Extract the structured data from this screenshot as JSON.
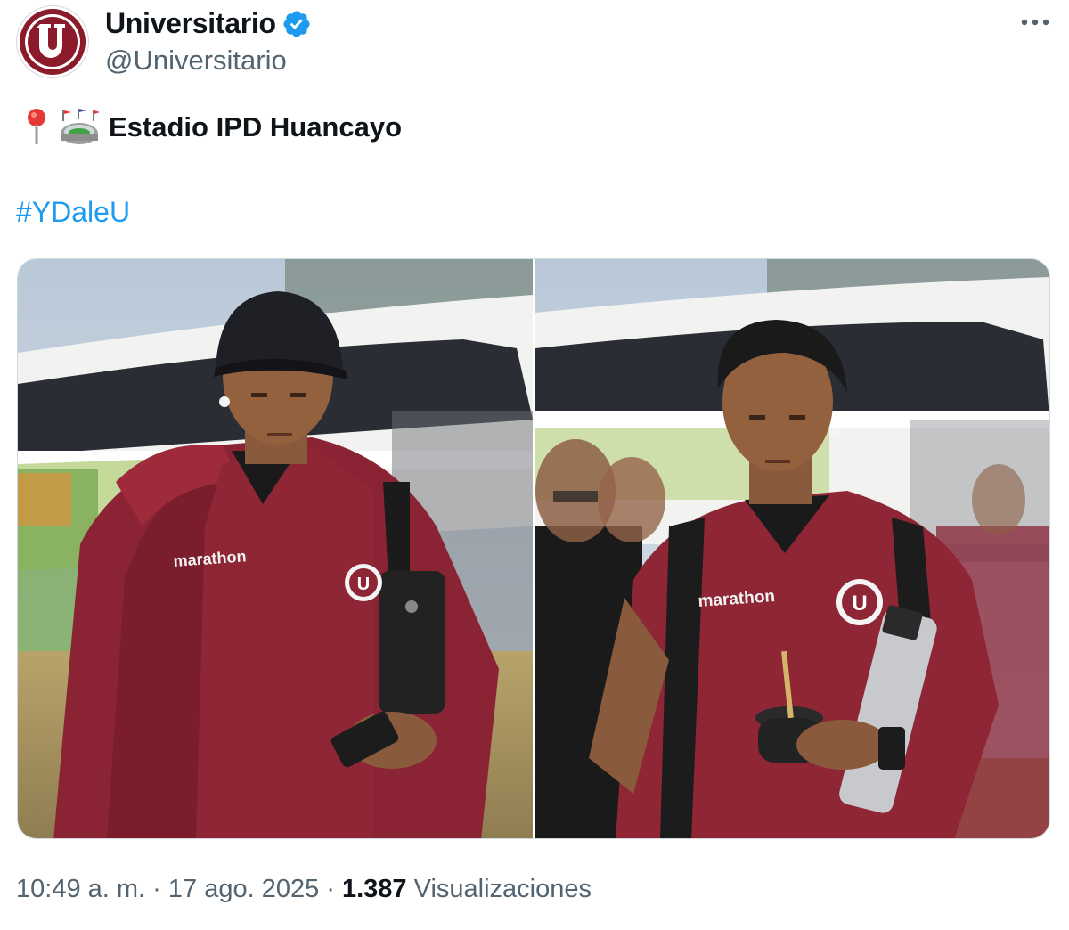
{
  "account": {
    "display_name": "Universitario",
    "handle": "@Universitario",
    "avatar_letter": "U",
    "verified_icon": "verified-badge-icon"
  },
  "tweet": {
    "location_emoji_icon": "round-pushpin-icon",
    "stadium_emoji_icon": "stadium-icon",
    "text": "Estadio IPD Huancayo",
    "hashtag": "#YDaleU"
  },
  "media": {
    "images": [
      {
        "alt_icon": "photo-player-cap",
        "shirt_brand": "marathon",
        "crest_letter": "U"
      },
      {
        "alt_icon": "photo-player-mate",
        "shirt_brand": "marathon",
        "crest_letter": "U"
      }
    ]
  },
  "footer": {
    "time": "10:49 a. m.",
    "separator": " · ",
    "date": "17 ago. 2025",
    "views_count": "1.387",
    "views_label": "Visualizaciones"
  },
  "colors": {
    "brand": "#8b1a2b",
    "link": "#1d9bf0",
    "secondary_text": "#536471",
    "verified": "#1d9bf0"
  }
}
